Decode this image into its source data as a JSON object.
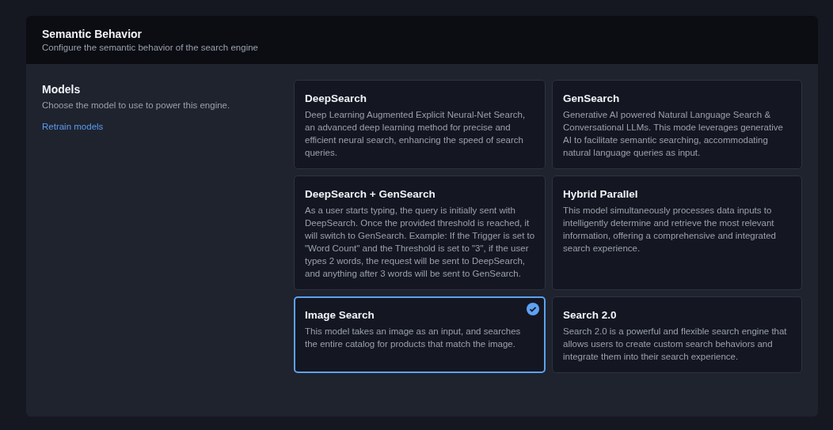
{
  "header": {
    "title": "Semantic Behavior",
    "subtitle": "Configure the semantic behavior of the search engine"
  },
  "section": {
    "title": "Models",
    "description": "Choose the model to use to power this engine.",
    "link": "Retrain models"
  },
  "models": [
    {
      "name": "DeepSearch",
      "description": "Deep Learning Augmented Explicit Neural-Net Search, an advanced deep learning method for precise and efficient neural search, enhancing the speed of search queries.",
      "selected": false
    },
    {
      "name": "GenSearch",
      "description": "Generative AI powered Natural Language Search & Conversational LLMs. This mode leverages generative AI to facilitate semantic searching, accommodating natural language queries as input.",
      "selected": false
    },
    {
      "name": "DeepSearch + GenSearch",
      "description": "As a user starts typing, the query is initially sent with DeepSearch. Once the provided threshold is reached, it will switch to GenSearch. Example: If the Trigger is set to \"Word Count\" and the Threshold is set to \"3\", if the user types 2 words, the request will be sent to DeepSearch, and anything after 3 words will be sent to GenSearch.",
      "selected": false
    },
    {
      "name": "Hybrid Parallel",
      "description": "This model simultaneously processes data inputs to intelligently determine and retrieve the most relevant information, offering a comprehensive and integrated search experience.",
      "selected": false
    },
    {
      "name": "Image Search",
      "description": "This model takes an image as an input, and searches the entire catalog for products that match the image.",
      "selected": true
    },
    {
      "name": "Search 2.0",
      "description": "Search 2.0 is a powerful and flexible search engine that allows users to create custom search behaviors and integrate them into their search experience.",
      "selected": false
    }
  ]
}
